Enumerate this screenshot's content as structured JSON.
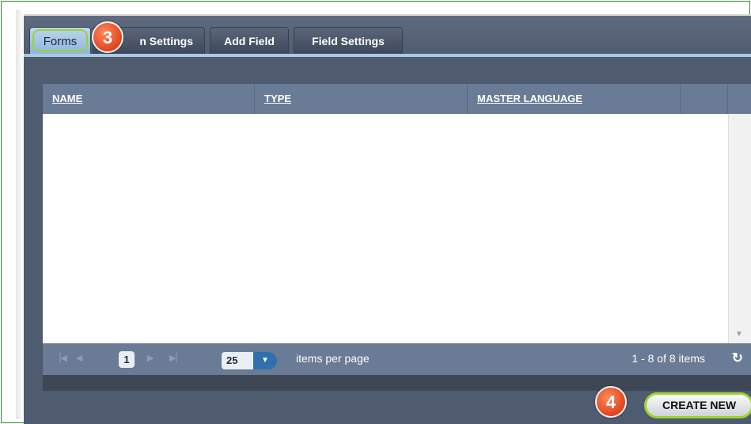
{
  "tabs": [
    {
      "label": "Forms",
      "active": true
    },
    {
      "label": "n Settings",
      "active": false
    },
    {
      "label": "Add Field",
      "active": false
    },
    {
      "label": "Field Settings",
      "active": false
    }
  ],
  "callouts": {
    "step3": "3",
    "step4": "4"
  },
  "grid": {
    "columns": [
      "NAME",
      "TYPE",
      "MASTER LANGUAGE",
      ""
    ],
    "rows": []
  },
  "pager": {
    "current_page": "1",
    "page_size": "25",
    "items_per_page_label": "items per page",
    "info": "1 - 8 of 8 items",
    "icons": [
      "first-page-icon",
      "prev-page-icon",
      "next-page-icon",
      "last-page-icon",
      "dropdown-arrow-icon",
      "refresh-icon"
    ]
  },
  "actions": {
    "create_new": "CREATE NEW"
  },
  "colors": {
    "panel": "#4f5b6e",
    "header": "#6a7b95",
    "highlight": "#9bd42a",
    "callout": "#e8562a",
    "active_tab": "#bcd6ef"
  }
}
